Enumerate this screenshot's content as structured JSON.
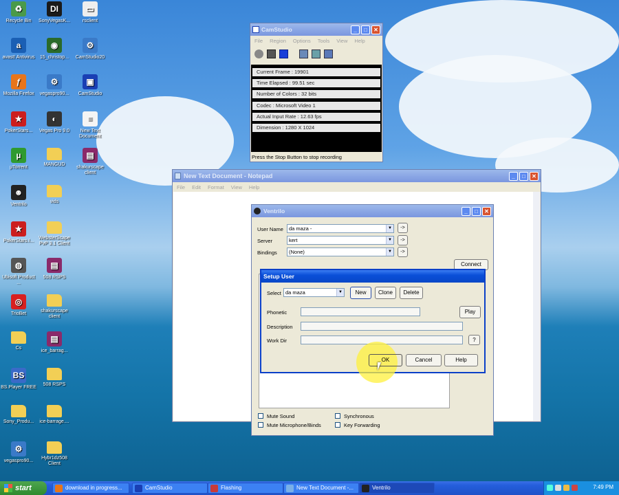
{
  "desktop": {
    "icons": [
      {
        "label": "Recycle Bin",
        "icon": "recycle-bin-icon",
        "color": "#4a9a4a",
        "glyph": "♻"
      },
      {
        "label": "SonyVegasK...",
        "icon": "app-icon",
        "color": "#1a1a1a",
        "glyph": "DI"
      },
      {
        "label": "rsclient",
        "icon": "file-icon",
        "color": "#eeeeee",
        "glyph": "▭"
      },
      {
        "label": "avast! Antivirus",
        "icon": "avast-icon",
        "color": "#1a5fb4",
        "glyph": "a"
      },
      {
        "label": "15_christop...",
        "icon": "media-icon",
        "color": "#2a6a2a",
        "glyph": "◉"
      },
      {
        "label": "CamStudio20",
        "icon": "setup-icon",
        "color": "#3a7ac8",
        "glyph": "⚙"
      },
      {
        "label": "Mozilla Firefox",
        "icon": "firefox-icon",
        "color": "#e8751a",
        "glyph": "ƒ"
      },
      {
        "label": "vegaspro90...",
        "icon": "setup-icon",
        "color": "#3a7ac8",
        "glyph": "⚙"
      },
      {
        "label": "CamStudio",
        "icon": "camstudio-icon",
        "color": "#1a3fb4",
        "glyph": "▣"
      },
      {
        "label": "PokerStars...",
        "icon": "pokerstars-icon",
        "color": "#cc1e1e",
        "glyph": "★"
      },
      {
        "label": "Vegas Pro 9.0",
        "icon": "vegas-icon",
        "color": "#333333",
        "glyph": "◐"
      },
      {
        "label": "New Text Document",
        "icon": "text-file-icon",
        "color": "#f4f4f4",
        "glyph": "≡"
      },
      {
        "label": "µTorrent",
        "icon": "utorrent-icon",
        "color": "#2f9a2f",
        "glyph": "µ"
      },
      {
        "label": "MANGUD",
        "icon": "folder-icon",
        "color": "#f2cf55",
        "glyph": ""
      },
      {
        "label": "shakurscape client",
        "icon": "winrar-icon",
        "color": "#8a2a6a",
        "glyph": "▤"
      },
      {
        "label": "Ventrilo",
        "icon": "ventrilo-icon",
        "color": "#222222",
        "glyph": "☻"
      },
      {
        "label": "vids",
        "icon": "folder-icon",
        "color": "#f2cf55",
        "glyph": ""
      },
      {
        "label": "PokerStars.I...",
        "icon": "pokerstars-icon",
        "color": "#cc1e1e",
        "glyph": "★"
      },
      {
        "label": "WebsterScape PvP 3.1 Client",
        "icon": "folder-icon",
        "color": "#f2cf55",
        "glyph": ""
      },
      {
        "label": "Ubisoft Product ...",
        "icon": "ubisoft-icon",
        "color": "#555555",
        "glyph": "◍"
      },
      {
        "label": "508 RSPS",
        "icon": "winrar-icon",
        "color": "#8a2a6a",
        "glyph": "▤"
      },
      {
        "label": "TrioBet",
        "icon": "triobet-icon",
        "color": "#d82020",
        "glyph": "◎"
      },
      {
        "label": "shakurscape client",
        "icon": "folder-icon",
        "color": "#f2cf55",
        "glyph": ""
      },
      {
        "label": "Cs",
        "icon": "folder-icon",
        "color": "#f2cf55",
        "glyph": ""
      },
      {
        "label": "ice_barrag...",
        "icon": "winrar-icon",
        "color": "#8a2a6a",
        "glyph": "▤"
      },
      {
        "label": "BS.Player FREE",
        "icon": "bsplayer-icon",
        "color": "#3a6ac8",
        "glyph": "BS"
      },
      {
        "label": "508 RSPS",
        "icon": "folder-icon",
        "color": "#f2cf55",
        "glyph": ""
      },
      {
        "label": "Sony_Produ...",
        "icon": "folder-icon",
        "color": "#f2cf55",
        "glyph": ""
      },
      {
        "label": "ice-barrage....",
        "icon": "folder-icon",
        "color": "#f2cf55",
        "glyph": ""
      },
      {
        "label": "vegaspro90...",
        "icon": "setup-icon",
        "color": "#3a7ac8",
        "glyph": "⚙"
      },
      {
        "label": "Hybr1dz508 Client",
        "icon": "folder-icon",
        "color": "#f2cf55",
        "glyph": ""
      }
    ]
  },
  "camstudio": {
    "title": "CamStudio",
    "menu": [
      "File",
      "Region",
      "Options",
      "Tools",
      "View",
      "Help"
    ],
    "stats": [
      "Current Frame : 19901",
      "Time Elapsed : 99.51 sec",
      "Number of Colors : 32 bits",
      "Codec : Microsoft Video 1",
      "Actual Input Rate : 12.63 fps",
      "Dimension : 1280 X 1024"
    ],
    "status": "Press the Stop Button to stop recording"
  },
  "notepad": {
    "title": "New Text Document - Notepad",
    "menu": [
      "File",
      "Edit",
      "Format",
      "View",
      "Help"
    ]
  },
  "ventrilo": {
    "title": "Ventrilo",
    "user_name_label": "User Name",
    "user_name_value": "da maza -",
    "server_label": "Server",
    "server_value": "kert",
    "bindings_label": "Bindings",
    "bindings_value": "(None)",
    "connect_label": "Connect",
    "mute_sound": "Mute Sound",
    "mute_mic": "Mute Microphone/Binds",
    "synchronous": "Synchronous",
    "key_forwarding": "Key Forwarding",
    "arrow": "->"
  },
  "setup_user": {
    "title": "Setup User",
    "select_label": "Select",
    "select_value": "da maza",
    "new_label": "New",
    "clone_label": "Clone",
    "delete_label": "Delete",
    "phonetic_label": "Phonetic",
    "play_label": "Play",
    "description_label": "Description",
    "workdir_label": "Work Dir",
    "browse_label": "?",
    "ok_label": "OK",
    "cancel_label": "Cancel",
    "help_label": "Help"
  },
  "taskbar": {
    "start_label": "start",
    "tasks": [
      {
        "label": "download in progress...",
        "icon": "firefox-icon",
        "color": "#e8751a"
      },
      {
        "label": "CamStudio",
        "icon": "camstudio-icon",
        "color": "#1a3fb4"
      },
      {
        "label": "Flashing",
        "icon": "app-icon",
        "color": "#c83a3a"
      },
      {
        "label": "New Text Document -...",
        "icon": "notepad-icon",
        "color": "#7ab0e8"
      },
      {
        "label": "Ventrilo",
        "icon": "ventrilo-icon",
        "color": "#222222"
      }
    ],
    "clock": "7:49 PM"
  }
}
